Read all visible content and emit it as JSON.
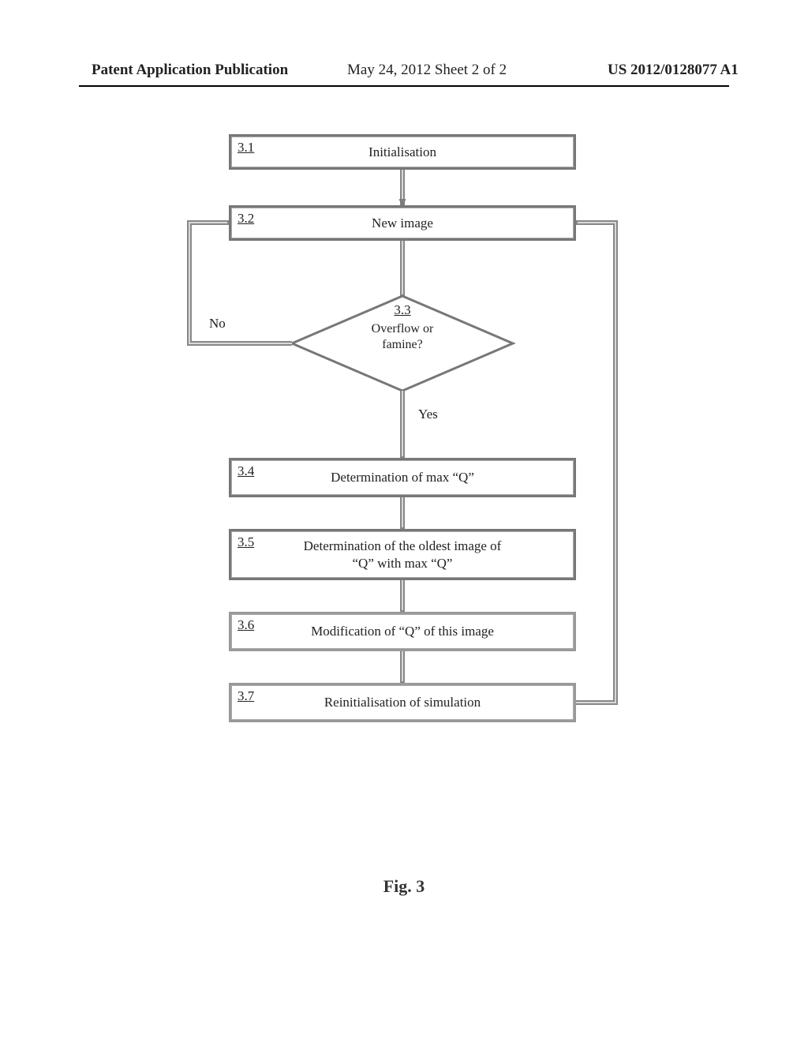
{
  "header": {
    "left": "Patent Application Publication",
    "center": "May 24, 2012  Sheet 2 of 2",
    "right": "US 2012/0128077 A1"
  },
  "nodes": {
    "n1": {
      "num": "3.1",
      "text": "Initialisation"
    },
    "n2": {
      "num": "3.2",
      "text": "New image"
    },
    "n3": {
      "num": "3.3",
      "text": "Overflow or\nfamine?"
    },
    "n4": {
      "num": "3.4",
      "text": "Determination of max “Q”"
    },
    "n5": {
      "num": "3.5",
      "text": "Determination of the oldest image of\n“Q” with max “Q”"
    },
    "n6": {
      "num": "3.6",
      "text": "Modification of “Q” of this image"
    },
    "n7": {
      "num": "3.7",
      "text": "Reinitialisation of simulation"
    }
  },
  "edges": {
    "no": "No",
    "yes": "Yes"
  },
  "caption": "Fig. 3",
  "chart_data": {
    "type": "flowchart",
    "nodes": [
      {
        "id": "3.1",
        "shape": "process",
        "label": "Initialisation"
      },
      {
        "id": "3.2",
        "shape": "process",
        "label": "New image"
      },
      {
        "id": "3.3",
        "shape": "decision",
        "label": "Overflow or famine?"
      },
      {
        "id": "3.4",
        "shape": "process",
        "label": "Determination of max “Q”"
      },
      {
        "id": "3.5",
        "shape": "process",
        "label": "Determination of the oldest image of “Q” with max “Q”"
      },
      {
        "id": "3.6",
        "shape": "process",
        "label": "Modification of “Q” of this image"
      },
      {
        "id": "3.7",
        "shape": "process",
        "label": "Reinitialisation of simulation"
      }
    ],
    "edges": [
      {
        "from": "3.1",
        "to": "3.2"
      },
      {
        "from": "3.2",
        "to": "3.3"
      },
      {
        "from": "3.3",
        "to": "3.2",
        "label": "No"
      },
      {
        "from": "3.3",
        "to": "3.4",
        "label": "Yes"
      },
      {
        "from": "3.4",
        "to": "3.5"
      },
      {
        "from": "3.5",
        "to": "3.6"
      },
      {
        "from": "3.6",
        "to": "3.7"
      },
      {
        "from": "3.7",
        "to": "3.2"
      }
    ]
  }
}
